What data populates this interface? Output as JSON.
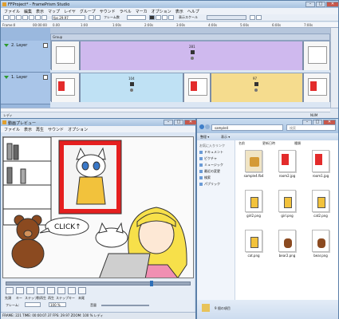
{
  "main": {
    "title": "FFProject* - FramePrism Studio",
    "menu": [
      "ファイル",
      "編集",
      "表示",
      "マップ",
      "レイヤ",
      "グループ",
      "サウンド",
      "ラベル",
      "マーカ",
      "オプション",
      "表示",
      "ヘルプ"
    ],
    "toolbar": {
      "fps_label": "fps 29.97",
      "frame_label": "フレーム数",
      "scale_label": "表示スケール"
    },
    "frame_readout": "Frame:0",
    "time_readout": "00:00:00",
    "ruler_ticks": [
      "0ms",
      "0.00",
      "1:00",
      "1:00s",
      "2:00s",
      "3:00s",
      "4:00s",
      "5:00s",
      "6:00s",
      "7:00s",
      "8:00s"
    ],
    "group_label": "Group",
    "layers": [
      {
        "name": "2. Layer",
        "clip_number": "281"
      },
      {
        "name": "1. Layer",
        "clip_numbers": [
          "104",
          "97"
        ]
      }
    ],
    "status": "レディ",
    "status_right": "NUM"
  },
  "preview": {
    "title": "動画プレビュー",
    "menu": [
      "ファイル",
      "表示",
      "再生",
      "サウンド",
      "オプション"
    ],
    "speech": "CLICK↑",
    "controls": [
      "先頭",
      "キー",
      "ステップ",
      "前再生",
      "再生",
      "ステップ",
      "キー",
      "末尾"
    ],
    "frame_label": "フレーム:",
    "zoom_label": "100 %",
    "volume_label": "音量",
    "status": "FRAME: 221 TIME: 00:00:07.37 FPS: 29.97 ZOOM: 100 % レディ"
  },
  "explorer": {
    "address": "sample4",
    "search_placeholder": "検索",
    "toolbar": [
      "整理 ▾",
      "表示 ▾"
    ],
    "columns": [
      "名前",
      "更新日時",
      "種類"
    ],
    "nav_header": "お気に入りリンク",
    "nav_items": [
      "ドキュメント",
      "ピクチャ",
      "ミュージック",
      "最近の変更",
      "検索",
      "パブリック"
    ],
    "files": [
      {
        "name": "sample4.fb4",
        "kind": "doc"
      },
      {
        "name": "room2.jpg",
        "kind": "room"
      },
      {
        "name": "room1.jpg",
        "kind": "room"
      },
      {
        "name": "girl2.png",
        "kind": "cat"
      },
      {
        "name": "girl.png",
        "kind": "cat"
      },
      {
        "name": "cat2.png",
        "kind": "cat"
      },
      {
        "name": "cat.png",
        "kind": "cat"
      },
      {
        "name": "bear2.png",
        "kind": "bear"
      },
      {
        "name": "bear.png",
        "kind": "bear"
      }
    ],
    "footer": "9 個の項目"
  }
}
